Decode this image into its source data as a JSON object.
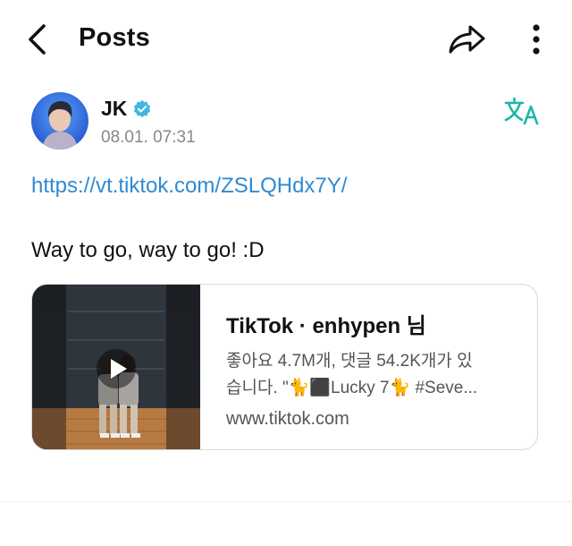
{
  "header": {
    "title": "Posts"
  },
  "post": {
    "author": "JK",
    "timestamp": "08.01. 07:31",
    "link": "https://vt.tiktok.com/ZSLQHdx7Y/",
    "text": "Way to go, way to go! :D"
  },
  "link_card": {
    "title": "TikTok · enhypen 님",
    "description_line1": "좋아요 4.7M개, 댓글 54.2K개가 있",
    "description_line2": "습니다. \"🐈⬛Lucky 7🐈 #Seve...",
    "domain": "www.tiktok.com"
  },
  "colors": {
    "link": "#2f8ad4",
    "verified": "#3fb6e6",
    "translate": "#1fb5a8",
    "secondary_text": "#888888"
  },
  "icons": {
    "back": "chevron-left-icon",
    "share": "share-icon",
    "more": "more-vertical-icon",
    "verified": "verified-badge-icon",
    "translate": "translate-icon",
    "play": "play-icon"
  }
}
